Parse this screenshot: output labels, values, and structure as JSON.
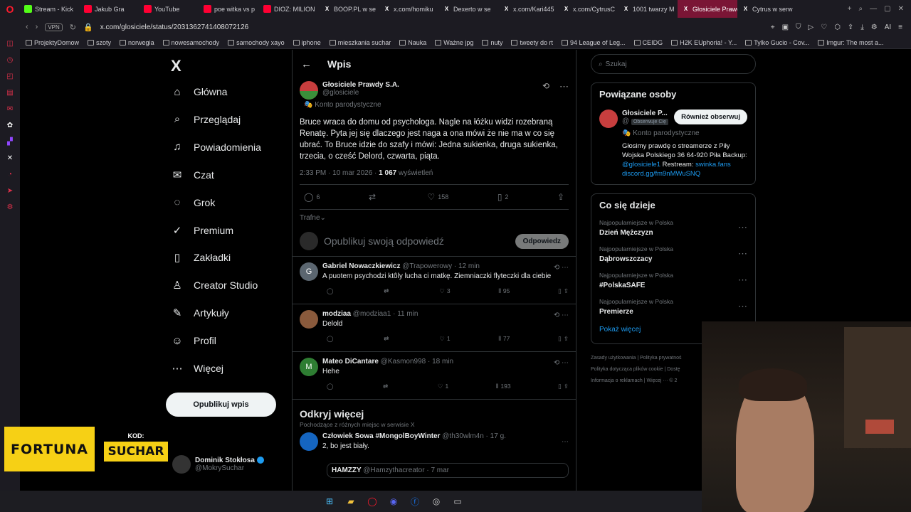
{
  "browser": {
    "tabs": [
      {
        "label": "Stream - Kick",
        "icon_color": "#53fc18"
      },
      {
        "label": "Jakub Gra",
        "icon_color": "#ff0033"
      },
      {
        "label": "YouTube",
        "icon_color": "#ff0033"
      },
      {
        "label": "poe witka vs p",
        "icon_color": "#ff0033"
      },
      {
        "label": "DIOZ: MILION",
        "icon_color": "#ff0033"
      },
      {
        "label": "BOOP.PL w se",
        "icon_color": "#ffffff"
      },
      {
        "label": "x.com/homiku",
        "icon_color": "#ffffff"
      },
      {
        "label": "Dexerto w se",
        "icon_color": "#ffffff"
      },
      {
        "label": "x.com/Kari445",
        "icon_color": "#ffffff"
      },
      {
        "label": "x.com/CytrusC",
        "icon_color": "#ffffff"
      },
      {
        "label": "1001 twarzy M",
        "icon_color": "#ffffff"
      },
      {
        "label": "Głosiciele Prawdy S.A. w",
        "icon_color": "#ffffff",
        "active": true
      },
      {
        "label": "Cytrus w serw",
        "icon_color": "#ffffff"
      }
    ],
    "url": "x.com/glosiciele/status/2031362741408072126",
    "vpn": "VPN",
    "ai_label": "AI",
    "bookmarks": [
      "ProjektyDomow",
      "szoty",
      "norwegia",
      "nowesamochody",
      "samochody xayo",
      "iphone",
      "mieszkania suchar",
      "Nauka",
      "Ważne jpg",
      "nuty",
      "tweety do rt",
      "94 League of Leg...",
      "CEIDG",
      "H2K EUphoria! - Y...",
      "Tylko Gucio - Cov...",
      "Imgur: The most a..."
    ]
  },
  "nav": {
    "logo": "X",
    "items": [
      {
        "label": "Główna",
        "icon": "home-icon",
        "glyph": "⌂"
      },
      {
        "label": "Przeglądaj",
        "icon": "search-icon",
        "glyph": "⌕"
      },
      {
        "label": "Powiadomienia",
        "icon": "bell-icon",
        "glyph": "♫"
      },
      {
        "label": "Czat",
        "icon": "mail-icon",
        "glyph": "✉"
      },
      {
        "label": "Grok",
        "icon": "grok-icon",
        "glyph": "◌"
      },
      {
        "label": "Premium",
        "icon": "premium-icon",
        "glyph": "✓"
      },
      {
        "label": "Zakładki",
        "icon": "bookmark-icon",
        "glyph": "▯"
      },
      {
        "label": "Creator Studio",
        "icon": "creator-icon",
        "glyph": "♙"
      },
      {
        "label": "Artykuły",
        "icon": "article-icon",
        "glyph": "✎"
      },
      {
        "label": "Profil",
        "icon": "profile-icon",
        "glyph": "☺"
      },
      {
        "label": "Więcej",
        "icon": "more-icon",
        "glyph": "⋯"
      }
    ],
    "post_button": "Opublikuj wpis",
    "account": {
      "name": "Dominik Stokłosa",
      "handle": "@MokrySuchar"
    }
  },
  "main": {
    "header_title": "Wpis",
    "tweet": {
      "name": "Głosiciele Prawdy S.A.",
      "handle": "@glosiciele",
      "parody": "Konto parodystyczne",
      "text": "Bruce wraca do domu od psychologa. Nagle na łóżku widzi rozebraną Renatę. Pyta jej się dlaczego jest naga a ona mówi że nie ma w co się ubrać. To Bruce idzie do szafy i mówi: Jedna sukienka, druga sukienka, trzecia, o cześć Delord, czwarta, piąta.",
      "time": "2:33 PM · 10 mar 2026 · ",
      "views_count": "1 067",
      "views_label": " wyświetleń",
      "replies": "6",
      "retweets": "",
      "likes": "158",
      "bookmarks": "2"
    },
    "sort": "Trafne",
    "reply_placeholder": "Opublikuj swoją odpowiedź",
    "reply_button": "Odpowiedz",
    "replies": [
      {
        "name": "Gabriel Nowaczkiewicz",
        "handle": "@Trapowerowy · 12 min",
        "text": "A puotem psychodzi ktôly lucha ci matkę. Ziemniaczki flyteczki dla ciebie",
        "reply": "",
        "rt": "",
        "likes": "3",
        "views": "95",
        "avatar_letter": "G",
        "avatar_color": "#5b6670"
      },
      {
        "name": "modziaa",
        "handle": "@modziaa1 · 11 min",
        "text": "Delold",
        "reply": "",
        "rt": "",
        "likes": "1",
        "views": "77",
        "avatar_letter": "",
        "avatar_color": "#8a5a3c"
      },
      {
        "name": "Mateo DiCantare",
        "handle": "@Kasmon998 · 18 min",
        "text": "Hehe",
        "reply": "",
        "rt": "",
        "likes": "1",
        "views": "193",
        "avatar_letter": "M",
        "avatar_color": "#2e7d32"
      }
    ],
    "discover": {
      "title": "Odkryj więcej",
      "subtitle": "Pochodzące z różnych miejsc w serwisie X"
    },
    "discover_post": {
      "name": "Człowiek Sowa #MongolBoyWinter",
      "handle": "@th30wlm4n · 17 g.",
      "text": "2, bo jest biały."
    },
    "quote": {
      "name": "HAMZZY",
      "handle": "@Hamzythacreator · 7 mar"
    }
  },
  "right": {
    "search_placeholder": "Szukaj",
    "related_title": "Powiązane osoby",
    "related": {
      "name": "Głosiciele P...",
      "handle": "@",
      "follows_you": "Obserwuje Cię",
      "follow_button": "Również obserwuj",
      "parody": "Konto parodystyczne",
      "bio_1": "Głosimy prawdę o streamerze z Piły Wojska Polskiego 36 64-920 Piła Backup: ",
      "bio_link": "@glosiciele1",
      "bio_2": " Restream: ",
      "bio_link2": "swinka.fans discord.gg/fm9nMWuSNQ"
    },
    "trends_title": "Co się dzieje",
    "trends": [
      {
        "context": "Najpopularniejsze w Polska",
        "name": "Dzień Mężczyzn"
      },
      {
        "context": "Najpopularniejsze w Polska",
        "name": "Dąbrowszczacy"
      },
      {
        "context": "Najpopularniejsze w Polska",
        "name": "#PolskaSAFE"
      },
      {
        "context": "Najpopularniejsze w Polska",
        "name": "Premierze"
      }
    ],
    "show_more": "Pokaż więcej",
    "footer_1": "Zasady użytkowania | Polityka prywatnoś",
    "footer_2": "Polityka dotycząca plików cookie | Dostę",
    "footer_3": "Informacja o reklamach | Więcej ··· © 2"
  },
  "overlay": {
    "brand": "FORTUNA",
    "code_label": "KOD:",
    "code_value": "SUCHAR"
  }
}
